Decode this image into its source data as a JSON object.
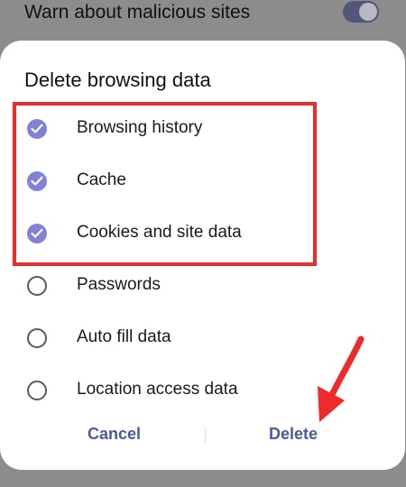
{
  "background": {
    "setting_label": "Warn about malicious sites",
    "toggle_on": true
  },
  "dialog": {
    "title": "Delete browsing data",
    "options": [
      {
        "label": "Browsing history",
        "checked": true
      },
      {
        "label": "Cache",
        "checked": true
      },
      {
        "label": "Cookies and site data",
        "checked": true
      },
      {
        "label": "Passwords",
        "checked": false
      },
      {
        "label": "Auto fill data",
        "checked": false
      },
      {
        "label": "Location access data",
        "checked": false
      }
    ],
    "cancel_label": "Cancel",
    "delete_label": "Delete"
  },
  "colors": {
    "checkbox_accent": "#8082d6",
    "button_text": "#4c5a9e",
    "annotation_red": "#ee2a2a"
  }
}
